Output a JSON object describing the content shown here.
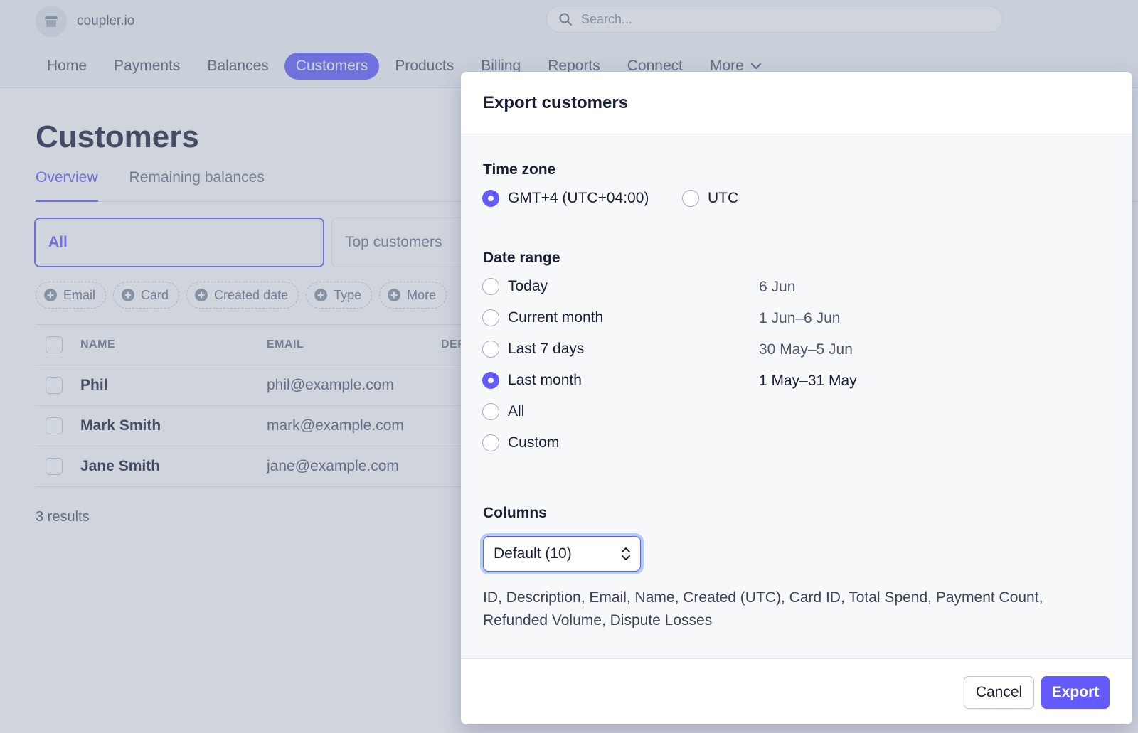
{
  "header": {
    "brand_name": "coupler.io",
    "search_placeholder": "Search..."
  },
  "nav": {
    "items": [
      "Home",
      "Payments",
      "Balances",
      "Customers",
      "Products",
      "Billing",
      "Reports",
      "Connect",
      "More"
    ],
    "active": "Customers"
  },
  "page": {
    "title": "Customers",
    "tabs": [
      "Overview",
      "Remaining balances"
    ],
    "active_tab": "Overview",
    "segments": [
      "All",
      "Top customers"
    ],
    "filters": [
      "Email",
      "Card",
      "Created date",
      "Type",
      "More"
    ],
    "table": {
      "headers": [
        "NAME",
        "EMAIL",
        "DEF"
      ],
      "rows": [
        {
          "name": "Phil",
          "email": "phil@example.com"
        },
        {
          "name": "Mark Smith",
          "email": "mark@example.com"
        },
        {
          "name": "Jane Smith",
          "email": "jane@example.com"
        }
      ]
    },
    "results": "3 results"
  },
  "modal": {
    "title": "Export customers",
    "timezone": {
      "label": "Time zone",
      "options": [
        {
          "label": "GMT+4 (UTC+04:00)",
          "selected": true
        },
        {
          "label": "UTC",
          "selected": false
        }
      ]
    },
    "date_range": {
      "label": "Date range",
      "options": [
        {
          "label": "Today",
          "range": "6 Jun",
          "selected": false
        },
        {
          "label": "Current month",
          "range": "1 Jun–6 Jun",
          "selected": false
        },
        {
          "label": "Last 7 days",
          "range": "30 May–5 Jun",
          "selected": false
        },
        {
          "label": "Last month",
          "range": "1 May–31 May",
          "selected": true
        },
        {
          "label": "All",
          "range": "",
          "selected": false
        },
        {
          "label": "Custom",
          "range": "",
          "selected": false
        }
      ]
    },
    "columns": {
      "label": "Columns",
      "selected": "Default (10)",
      "description": "ID, Description, Email, Name, Created (UTC), Card ID, Total Spend, Payment Count, Refunded Volume, Dispute Losses"
    },
    "buttons": {
      "cancel": "Cancel",
      "export": "Export"
    }
  },
  "colors": {
    "accent": "#635bff",
    "text": "#1a1f36",
    "muted": "#697386"
  }
}
